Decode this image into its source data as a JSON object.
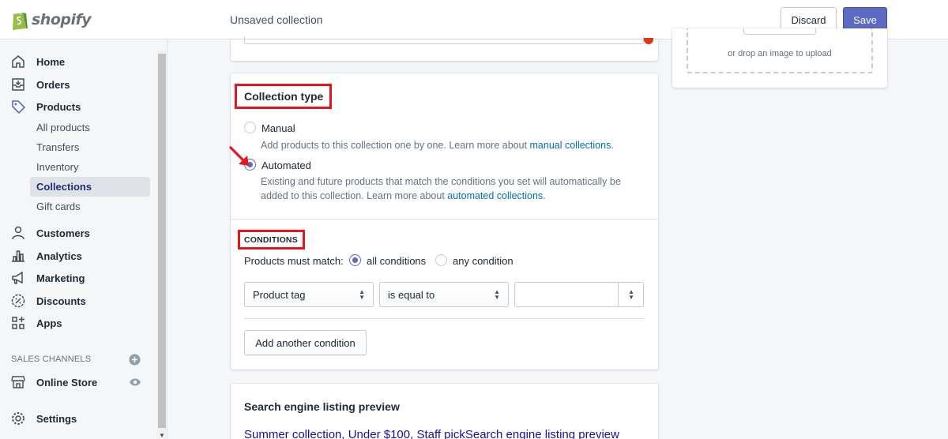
{
  "app": {
    "logo_text": "shopify"
  },
  "header": {
    "title": "Unsaved collection",
    "discard_label": "Discard",
    "save_label": "Save"
  },
  "sidebar": {
    "items": [
      {
        "label": "Home",
        "icon": "home-icon"
      },
      {
        "label": "Orders",
        "icon": "orders-icon"
      },
      {
        "label": "Products",
        "icon": "tag-icon"
      },
      {
        "label": "Customers",
        "icon": "customers-icon"
      },
      {
        "label": "Analytics",
        "icon": "analytics-icon"
      },
      {
        "label": "Marketing",
        "icon": "megaphone-icon"
      },
      {
        "label": "Discounts",
        "icon": "discount-icon"
      },
      {
        "label": "Apps",
        "icon": "apps-icon"
      }
    ],
    "product_subitems": [
      "All products",
      "Transfers",
      "Inventory",
      "Collections",
      "Gift cards"
    ],
    "active_subitem": "Collections",
    "sales_channels_title": "SALES CHANNELS",
    "online_store_label": "Online Store",
    "settings_label": "Settings"
  },
  "collection_type": {
    "title": "Collection type",
    "manual_label": "Manual",
    "manual_help": "Add products to this collection one by one. Learn more about ",
    "manual_link": "manual collections",
    "automated_label": "Automated",
    "automated_help": "Existing and future products that match the conditions you set will automatically be added to this collection. Learn more about ",
    "automated_link": "automated collections",
    "selected": "Automated"
  },
  "conditions": {
    "title": "CONDITIONS",
    "match_label": "Products must match:",
    "all_label": "all conditions",
    "any_label": "any condition",
    "match_selected": "all conditions",
    "field_value": "Product tag",
    "operator_value": "is equal to",
    "value": "",
    "add_label": "Add another condition"
  },
  "seo": {
    "title": "Search engine listing preview",
    "preview_text": "Summer collection, Under $100, Staff pickSearch engine listing preview"
  },
  "image_upload": {
    "drop_text": "or drop an image to upload"
  },
  "colors": {
    "accent": "#5c6ac4",
    "highlight": "#e8141e",
    "link": "#006fbb"
  }
}
